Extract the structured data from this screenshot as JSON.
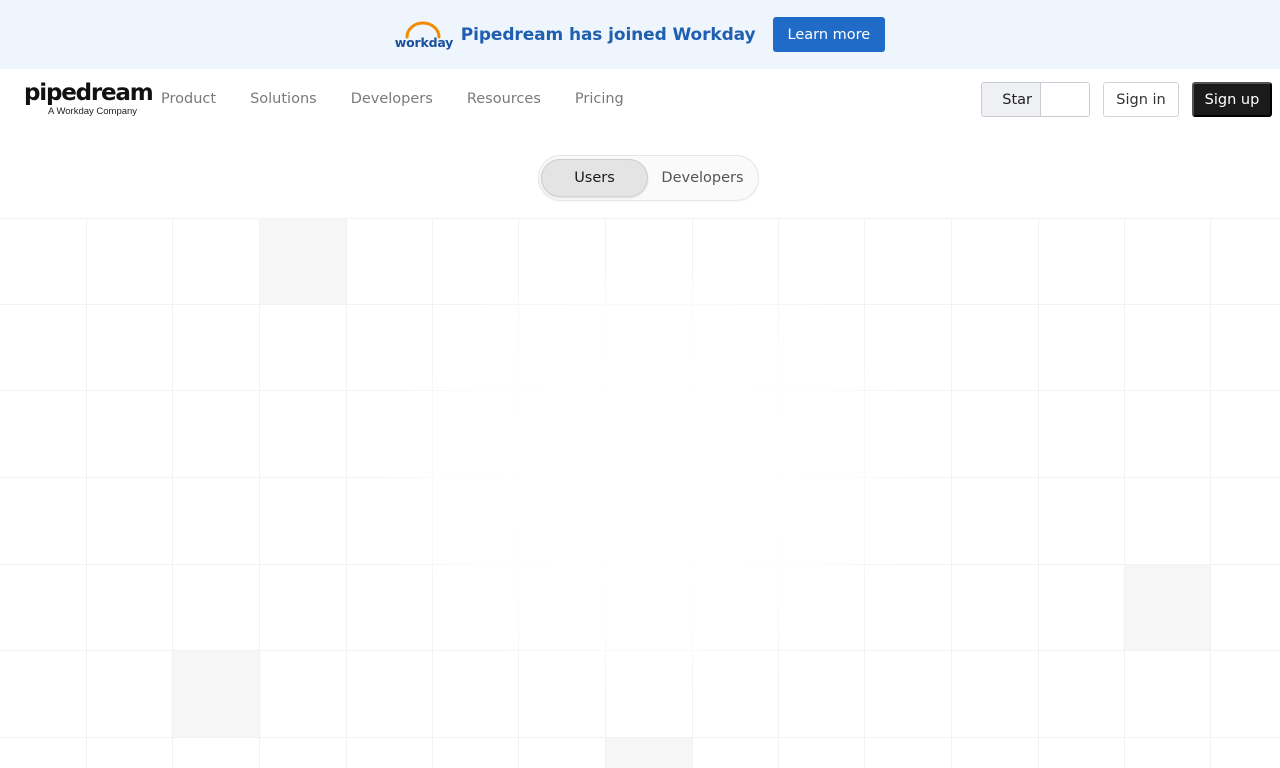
{
  "banner": {
    "logo_text": "workday",
    "title": "Pipedream has joined Workday",
    "cta_label": "Learn more",
    "logo_arc_color": "#f38b00",
    "accent": "#1f6bc7"
  },
  "nav": {
    "brand_name": "pipedream",
    "brand_subtitle": "A Workday Company",
    "links": [
      {
        "label": "Product"
      },
      {
        "label": "Solutions"
      },
      {
        "label": "Developers"
      },
      {
        "label": "Resources"
      },
      {
        "label": "Pricing"
      }
    ],
    "star_label": "Star",
    "signin_label": "Sign in",
    "signup_label": "Sign up"
  },
  "toggle": {
    "options": [
      "Users",
      "Developers"
    ],
    "selected": "Users"
  }
}
